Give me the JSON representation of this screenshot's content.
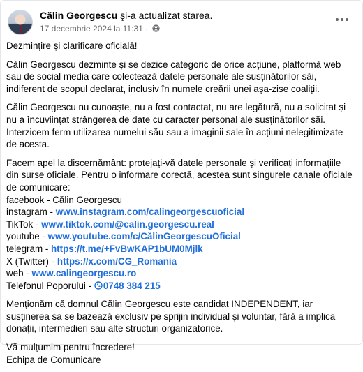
{
  "post": {
    "author": "Călin Georgescu",
    "action": "şi-a actualizat starea.",
    "date": "17 decembrie 2024 la 11:31",
    "separator": "·",
    "title": "Dezmințire și clarificare oficială!",
    "p1": "Călin Georgescu dezminte și se dezice categoric de orice acțiune, platformă web sau de social media care colectează datele personale ale susținătorilor săi, indiferent de scopul declarat, inclusiv în numele creării unei așa-zise coaliții.",
    "p2": "Călin Georgescu nu cunoaște, nu a fost contactat, nu are legătură, nu a solicitat și nu a încuviințat strângerea de date cu caracter personal ale susținătorilor săi. Interzicem ferm utilizarea numelui său sau a imaginii sale în acțiuni nelegitimizate de acesta.",
    "p3": "Facem apel la discernământ: protejați-vă datele personale și verificați informațiile din surse oficiale. Pentru o informare corectă, acestea sunt singurele canale oficiale de comunicare:",
    "channels": [
      {
        "label": "facebook - Călin Georgescu",
        "link": ""
      },
      {
        "label": "instagram - ",
        "link": "www.instagram.com/calingeorgescuoficial"
      },
      {
        "label": "TikTok - ",
        "link": "www.tiktok.com/@calin.georgescu.real"
      },
      {
        "label": "youtube - ",
        "link": "www.youtube.com/c/CălinGeorgescuOficial"
      },
      {
        "label": "telegram - ",
        "link": "https://t.me/+FvBwKAP1bUM0Mjlk"
      },
      {
        "label": "X (Twitter) - ",
        "link": "https://x.com/CG_Romania"
      },
      {
        "label": "web - ",
        "link": "www.calingeorgescu.ro"
      },
      {
        "label": "Telefonul Poporului - ",
        "link": "0748 384 215"
      }
    ],
    "p4": "Menționăm că domnul Călin Georgescu este candidat INDEPENDENT, iar susținerea sa se bazează exclusiv pe sprijin individual și voluntar, fără a implica donații, intermedieri sau alte structuri organizatorice.",
    "thanks": "Vă mulțumim pentru încredere!",
    "signature": "Echipa de Comunicare"
  },
  "icons": {
    "globe": "globe-icon",
    "more": "more-options-icon",
    "phone": "phone-icon"
  },
  "colors": {
    "link": "#216fdb",
    "meta": "#65676b",
    "text": "#050505"
  }
}
